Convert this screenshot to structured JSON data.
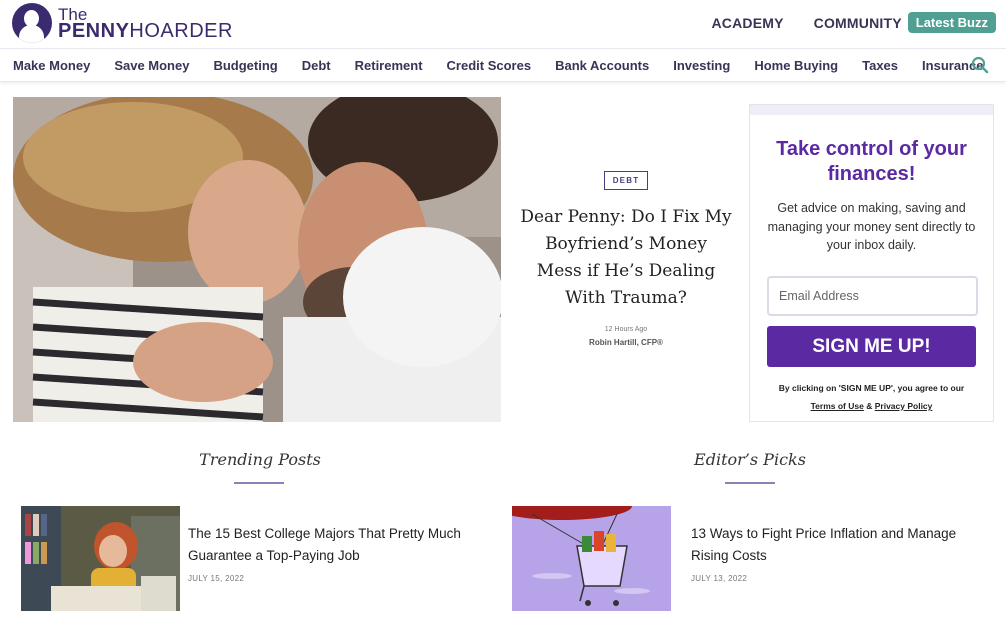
{
  "header": {
    "logo_the": "The",
    "logo_penny": "PENNY",
    "logo_hoarder": "HOARDER",
    "links": [
      "ACADEMY",
      "COMMUNITY"
    ],
    "buzz": "Latest Buzz"
  },
  "nav": {
    "items": [
      "Make Money",
      "Save Money",
      "Budgeting",
      "Debt",
      "Retirement",
      "Credit Scores",
      "Bank Accounts",
      "Investing",
      "Home Buying",
      "Taxes",
      "Insurance"
    ],
    "search_icon": "search-icon"
  },
  "hero": {
    "tag": "DEBT",
    "title": "Dear Penny: Do I Fix My Boyfriend’s Money Mess if He’s Dealing With Trauma?",
    "time": "12 Hours Ago",
    "author": "Robin Hartill, CFP®"
  },
  "signup": {
    "title": "Take control of your finances!",
    "description": "Get advice on making, saving and managing your money sent directly to your inbox daily.",
    "email_placeholder": "Email Address",
    "button": "SIGN ME UP!",
    "disclaimer": "By clicking on 'SIGN ME UP', you agree to our",
    "terms": "Terms of Use",
    "and": "&",
    "privacy": "Privacy Policy"
  },
  "trending": {
    "heading": "Trending Posts",
    "post_title": "The 15 Best College Majors That Pretty Much Guarantee a Top-Paying Job",
    "post_date": "JULY 15, 2022"
  },
  "editors": {
    "heading": "Editor’s Picks",
    "post_title": "13 Ways to Fight Price Inflation and Manage Rising Costs",
    "post_date": "JULY 13, 2022"
  },
  "colors": {
    "brand_purple": "#3c2a6e",
    "accent_purple": "#5b2aa3",
    "teal": "#4fa093"
  }
}
